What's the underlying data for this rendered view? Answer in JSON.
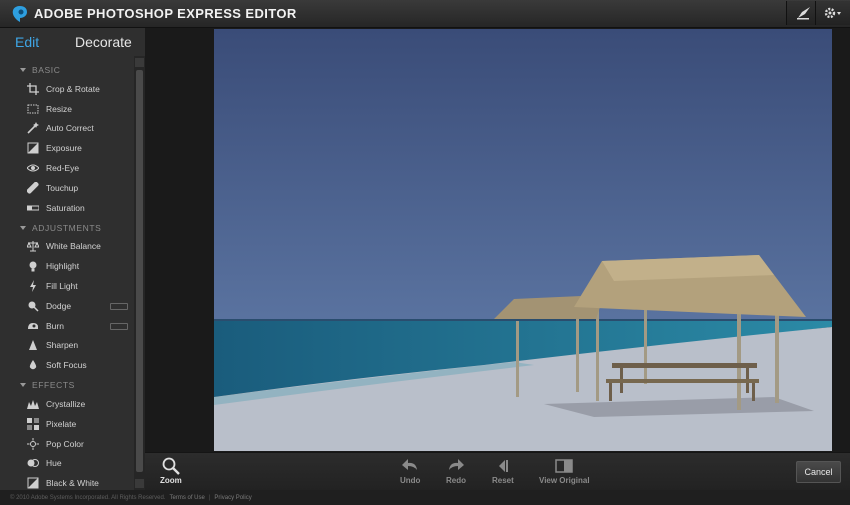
{
  "header": {
    "title": "ADOBE PHOTOSHOP EXPRESS EDITOR",
    "logo_icon": "photoshop-express-logo-icon",
    "right_buttons": [
      "brush-icon",
      "gear-icon"
    ]
  },
  "tabs": {
    "edit": "Edit",
    "decorate": "Decorate"
  },
  "sidebar": {
    "sections": [
      {
        "title": "BASIC",
        "items": [
          {
            "label": "Crop & Rotate",
            "icon": "crop-icon"
          },
          {
            "label": "Resize",
            "icon": "resize-icon"
          },
          {
            "label": "Auto Correct",
            "icon": "magic-wand-icon"
          },
          {
            "label": "Exposure",
            "icon": "exposure-icon"
          },
          {
            "label": "Red-Eye",
            "icon": "eye-icon"
          },
          {
            "label": "Touchup",
            "icon": "bandage-icon"
          },
          {
            "label": "Saturation",
            "icon": "saturation-icon"
          }
        ]
      },
      {
        "title": "ADJUSTMENTS",
        "items": [
          {
            "label": "White Balance",
            "icon": "scale-icon"
          },
          {
            "label": "Highlight",
            "icon": "bulb-icon"
          },
          {
            "label": "Fill Light",
            "icon": "lightning-icon"
          },
          {
            "label": "Dodge",
            "icon": "dodge-icon",
            "tag": true
          },
          {
            "label": "Burn",
            "icon": "burn-icon",
            "tag": true
          },
          {
            "label": "Sharpen",
            "icon": "triangle-icon"
          },
          {
            "label": "Soft Focus",
            "icon": "drop-icon"
          }
        ]
      },
      {
        "title": "EFFECTS",
        "items": [
          {
            "label": "Crystallize",
            "icon": "crystal-icon"
          },
          {
            "label": "Pixelate",
            "icon": "pixelate-icon"
          },
          {
            "label": "Pop Color",
            "icon": "pop-color-icon"
          },
          {
            "label": "Hue",
            "icon": "hue-icon"
          },
          {
            "label": "Black & White",
            "icon": "black-white-icon"
          }
        ]
      }
    ]
  },
  "toolbar": {
    "zoom": "Zoom",
    "undo": "Undo",
    "redo": "Redo",
    "reset": "Reset",
    "view_original": "View Original",
    "cancel": "Cancel"
  },
  "footer": {
    "copyright": "© 2010 Adobe Systems Incorporated. All Rights Reserved.",
    "terms": "Terms of Use",
    "separator": "|",
    "privacy": "Privacy Policy"
  },
  "colors": {
    "accent": "#3fa6e6",
    "panel": "#2f2f2f",
    "topbar": "#2e2e2e"
  }
}
